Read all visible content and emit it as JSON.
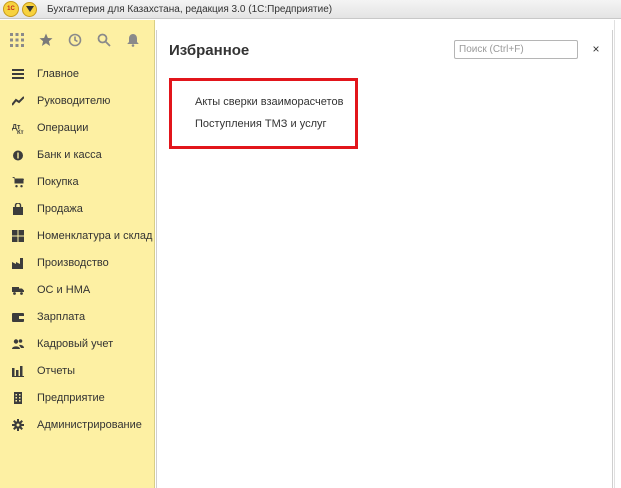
{
  "window": {
    "logo_text": "1С",
    "title": "Бухгалтерия для Казахстана, редакция 3.0  (1С:Предприятие)"
  },
  "sidebar": {
    "toolbar": [
      {
        "name": "apps-grid-icon"
      },
      {
        "name": "star-icon"
      },
      {
        "name": "history-icon"
      },
      {
        "name": "search-icon"
      },
      {
        "name": "bell-icon"
      }
    ],
    "items": [
      {
        "label": "Главное",
        "icon": "menu-lines-icon"
      },
      {
        "label": "Руководителю",
        "icon": "trend-icon"
      },
      {
        "label": "Операции",
        "icon": "debit-credit-icon"
      },
      {
        "label": "Банк и касса",
        "icon": "money-bag-icon"
      },
      {
        "label": "Покупка",
        "icon": "cart-icon"
      },
      {
        "label": "Продажа",
        "icon": "shopping-bag-icon"
      },
      {
        "label": "Номенклатура и склад",
        "icon": "grid-icon"
      },
      {
        "label": "Производство",
        "icon": "factory-icon"
      },
      {
        "label": "ОС и НМА",
        "icon": "truck-icon"
      },
      {
        "label": "Зарплата",
        "icon": "wallet-icon"
      },
      {
        "label": "Кадровый учет",
        "icon": "people-icon"
      },
      {
        "label": "Отчеты",
        "icon": "bar-chart-icon"
      },
      {
        "label": "Предприятие",
        "icon": "building-icon"
      },
      {
        "label": "Администрирование",
        "icon": "gear-icon"
      }
    ]
  },
  "panel": {
    "title": "Избранное",
    "search_placeholder": "Поиск (Ctrl+F)",
    "close_label": "×",
    "favorites": [
      "Акты сверки взаиморасчетов",
      "Поступления ТМЗ и услуг"
    ]
  },
  "colors": {
    "sidebar_bg": "#fdf0a3",
    "highlight_border": "#e2151b",
    "logo_yellow": "#f7d23e"
  }
}
